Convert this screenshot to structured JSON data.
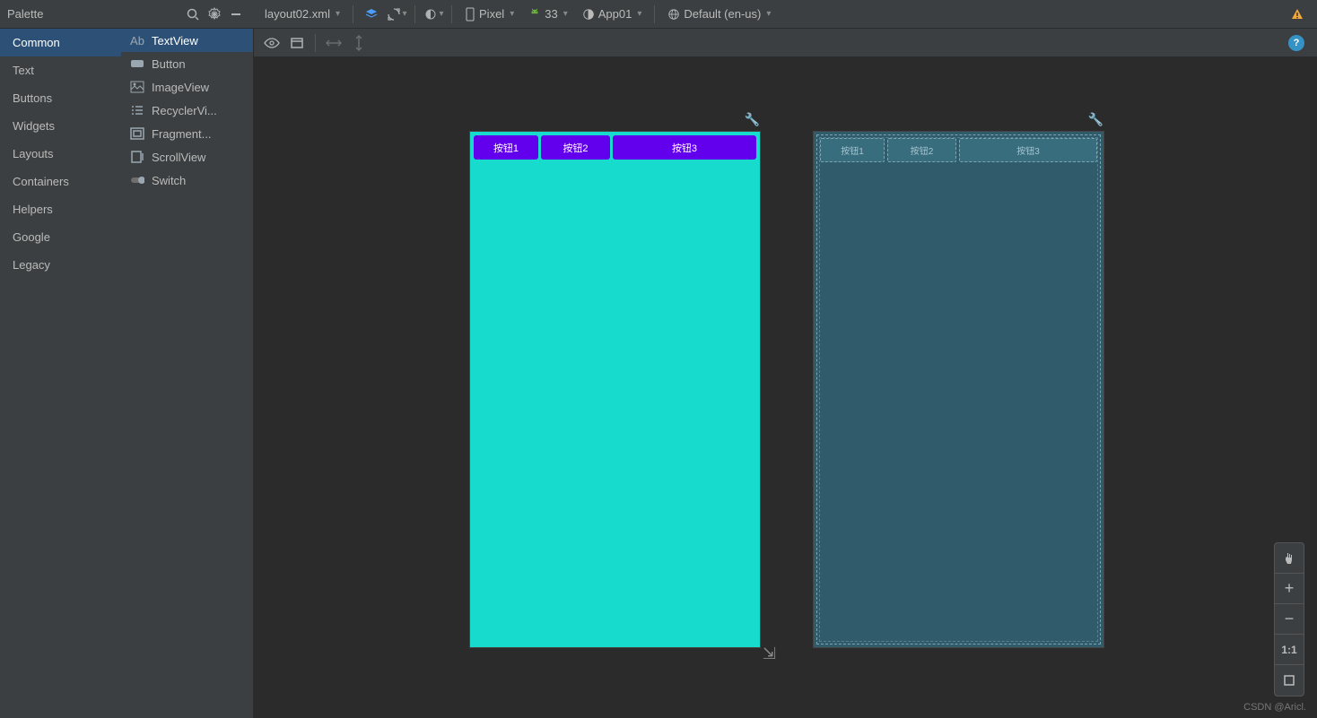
{
  "palette": {
    "title": "Palette",
    "categories": [
      "Common",
      "Text",
      "Buttons",
      "Widgets",
      "Layouts",
      "Containers",
      "Helpers",
      "Google",
      "Legacy"
    ],
    "selected_category": "Common",
    "components": [
      "TextView",
      "Button",
      "ImageView",
      "RecyclerVi...",
      "Fragment...",
      "ScrollView",
      "Switch"
    ],
    "selected_component": "TextView"
  },
  "toolbar": {
    "file_name": "layout02.xml",
    "device": "Pixel",
    "api": "33",
    "app": "App01",
    "locale": "Default (en-us)"
  },
  "preview": {
    "button1": "按钮1",
    "button2": "按钮2",
    "button3": "按钮3"
  },
  "blueprint": {
    "button1": "按钮1",
    "button2": "按钮2",
    "button3": "按钮3"
  },
  "zoom": {
    "ratio": "1:1"
  },
  "watermark": "CSDN @Aricl."
}
